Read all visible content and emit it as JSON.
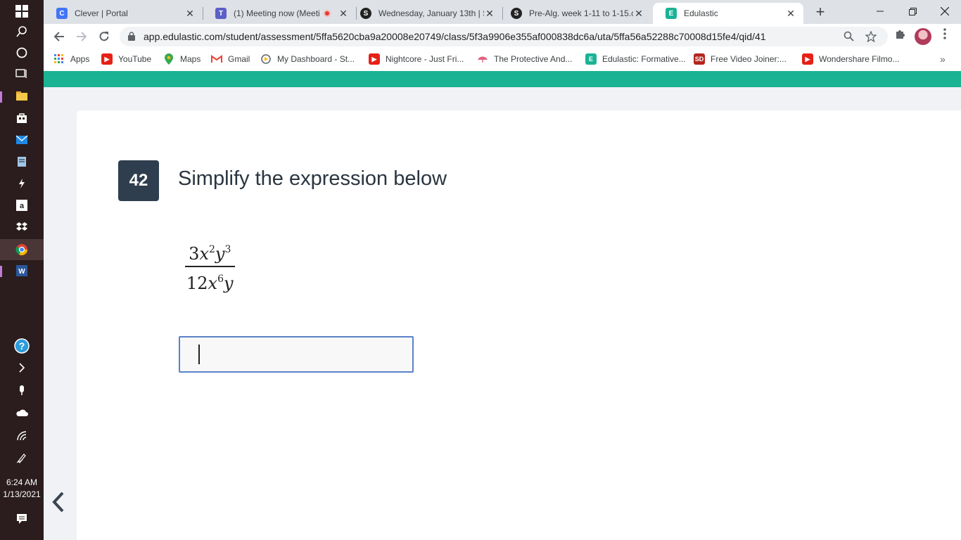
{
  "taskbar": {
    "time": "6:24 AM",
    "date": "1/13/2021"
  },
  "tabs": [
    {
      "title": "Clever | Portal",
      "favicon_letter": "C",
      "favicon_color": "#4274f6",
      "active": false
    },
    {
      "title": "(1) Meeting now (Meeti",
      "favicon_letter": "T",
      "favicon_color": "#5b5fc7",
      "active": false
    },
    {
      "title": "Wednesday, January 13th | S",
      "favicon_letter": "S",
      "favicon_color": "#222222",
      "active": false
    },
    {
      "title": "Pre-Alg. week 1-11 to 1-15.c",
      "favicon_letter": "S",
      "favicon_color": "#222222",
      "active": false
    },
    {
      "title": "Edulastic",
      "favicon_letter": "E",
      "favicon_color": "#1ab394",
      "active": true
    }
  ],
  "address": {
    "url": "app.edulastic.com/student/assessment/5ffa5620cba9a20008e20749/class/5f3a9906e355af000838dc6a/uta/5ffa56a52288c70008d15fe4/qid/41"
  },
  "bookmarks": [
    {
      "label": "Apps",
      "icon": "apps-grid-icon",
      "color": "#4285f4"
    },
    {
      "label": "YouTube",
      "icon": "youtube-icon",
      "color": "#e62117"
    },
    {
      "label": "Maps",
      "icon": "maps-icon",
      "color": "#34a853"
    },
    {
      "label": "Gmail",
      "icon": "gmail-icon",
      "color": "#ea4335"
    },
    {
      "label": "My Dashboard - St...",
      "icon": "dashboard-icon",
      "color": "#5f6368"
    },
    {
      "label": "Nightcore - Just Fri...",
      "icon": "youtube-icon",
      "color": "#e62117"
    },
    {
      "label": "The Protective And...",
      "icon": "umbrella-icon",
      "color": "#e0607e"
    },
    {
      "label": "Edulastic: Formative...",
      "icon": "edulastic-icon",
      "color": "#1ab394"
    },
    {
      "label": "Free Video Joiner:...",
      "icon": "video-joiner-icon",
      "color": "#b3261e"
    },
    {
      "label": "Wondershare Filmo...",
      "icon": "youtube-icon",
      "color": "#e62117"
    }
  ],
  "question": {
    "number": "42",
    "prompt": "Simplify the expression below",
    "numerator": {
      "coef": "3",
      "var1": "x",
      "exp1": "2",
      "var2": "y",
      "exp2": "3"
    },
    "denominator": {
      "coef": "12",
      "var1": "x",
      "exp1": "6",
      "var2": "y"
    },
    "answer_value": ""
  },
  "colors": {
    "accent": "#1ab394",
    "question_badge": "#2f3e4e",
    "input_border": "#5a82c8"
  }
}
